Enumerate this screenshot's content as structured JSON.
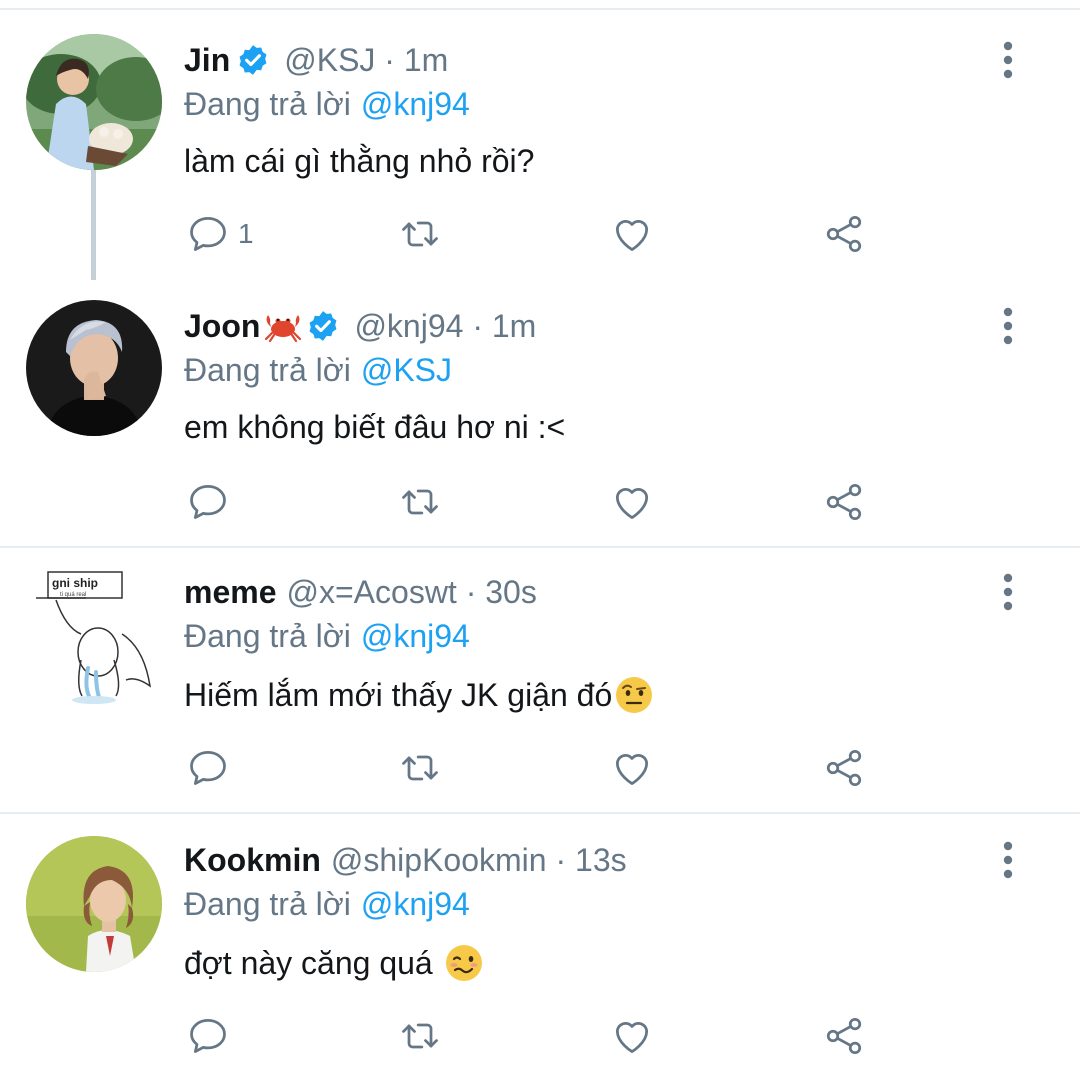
{
  "tweets": [
    {
      "name": "Jin",
      "verified": true,
      "handle_time": "@KSJ · 1m",
      "replying_prefix": "Đang trả lời",
      "replying_to": "@knj94",
      "text": "làm cái gì thằng nhỏ rồi?",
      "reply_count": "1"
    },
    {
      "name": "Joon",
      "verified": true,
      "name_emoji": "crab",
      "handle_time": "@knj94 · 1m",
      "replying_prefix": "Đang trả lời",
      "replying_to": "@KSJ",
      "text": "em không biết đâu hơ ni :<",
      "reply_count": ""
    },
    {
      "name": "meme",
      "verified": false,
      "handle_time": "@x=Acoswt · 30s",
      "replying_prefix": "Đang trả lời",
      "replying_to": "@knj94",
      "text": "Hiếm lắm mới thấy JK giận đó",
      "text_emoji": "face-with-raised-eyebrow",
      "reply_count": "",
      "avatar_sign": "gni ship",
      "avatar_sign_sub": "ti quá real"
    },
    {
      "name": "Kookmin",
      "verified": false,
      "handle_time": "@shipKookmin · 13s",
      "replying_prefix": "Đang trả lời",
      "replying_to": "@knj94",
      "text": "đợt này căng quá ",
      "text_emoji": "woozy-face",
      "reply_count": ""
    }
  ],
  "icons": {
    "reply": "reply-bubble-icon",
    "retweet": "retweet-icon",
    "like": "heart-icon",
    "share": "share-icon",
    "more": "more-vertical-icon",
    "verified": "verified-badge-icon"
  },
  "colors": {
    "accent": "#1da1f2",
    "secondary_text": "#657786",
    "divider": "#e6ecf0"
  }
}
